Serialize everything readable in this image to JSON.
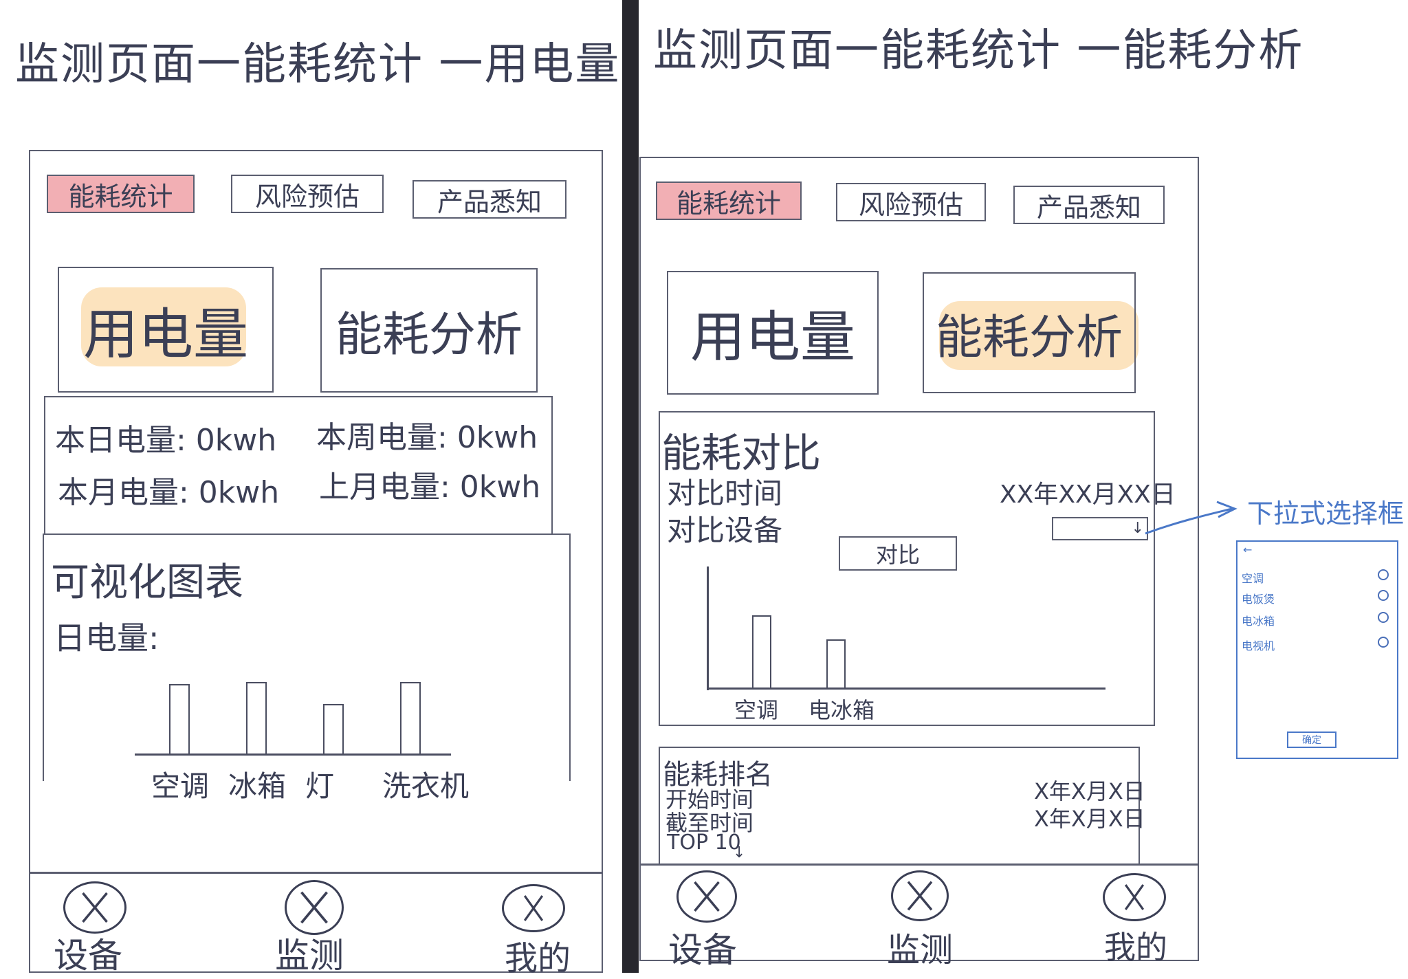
{
  "left": {
    "title": "监测页面一能耗统计 一用电量",
    "tabs": [
      "能耗统计",
      "风险预估",
      "产品悉知"
    ],
    "subtabs": [
      "用电量",
      "能耗分析"
    ],
    "stats": {
      "today": "本日电量: 0kwh",
      "week": "本周电量: 0kwh",
      "month": "本月电量: 0kwh",
      "last_month": "上月电量: 0kwh"
    },
    "chart_section": {
      "title": "可视化图表",
      "label": "日电量:"
    },
    "chart_data": {
      "type": "bar",
      "categories": [
        "空调",
        "冰箱",
        "灯",
        "洗衣机"
      ],
      "values": [
        0.78,
        0.8,
        0.55,
        0.8
      ]
    },
    "nav": [
      "设备",
      "监测",
      "我的"
    ]
  },
  "right": {
    "title": "监测页面一能耗统计 一能耗分析",
    "tabs": [
      "能耗统计",
      "风险预估",
      "产品悉知"
    ],
    "subtabs": [
      "用电量",
      "能耗分析"
    ],
    "compare": {
      "title": "能耗对比",
      "time_label": "对比时间",
      "time_value": "XX年XX月XX日",
      "device_label": "对比设备",
      "button": "对比"
    },
    "chart_data": {
      "type": "bar",
      "categories": [
        "空调",
        "电冰箱"
      ],
      "values": [
        0.75,
        0.5
      ]
    },
    "ranking": {
      "title": "能耗排名",
      "start_label": "开始时间",
      "start_value": "X年X月X日",
      "end_label": "截至时间",
      "end_value": "X年X月X日",
      "top": "TOP 10"
    },
    "nav": [
      "设备",
      "监测",
      "我的"
    ],
    "annotation": {
      "text": "下拉式选择框",
      "options": [
        "空调",
        "电饭煲",
        "电冰箱",
        "电视机"
      ],
      "confirm": "确定",
      "back": "←"
    }
  },
  "colors": {
    "ink": "#3b3f55",
    "active_tab": "#e76e76",
    "highlight": "#fad49b",
    "annotation": "#4a78c8"
  }
}
